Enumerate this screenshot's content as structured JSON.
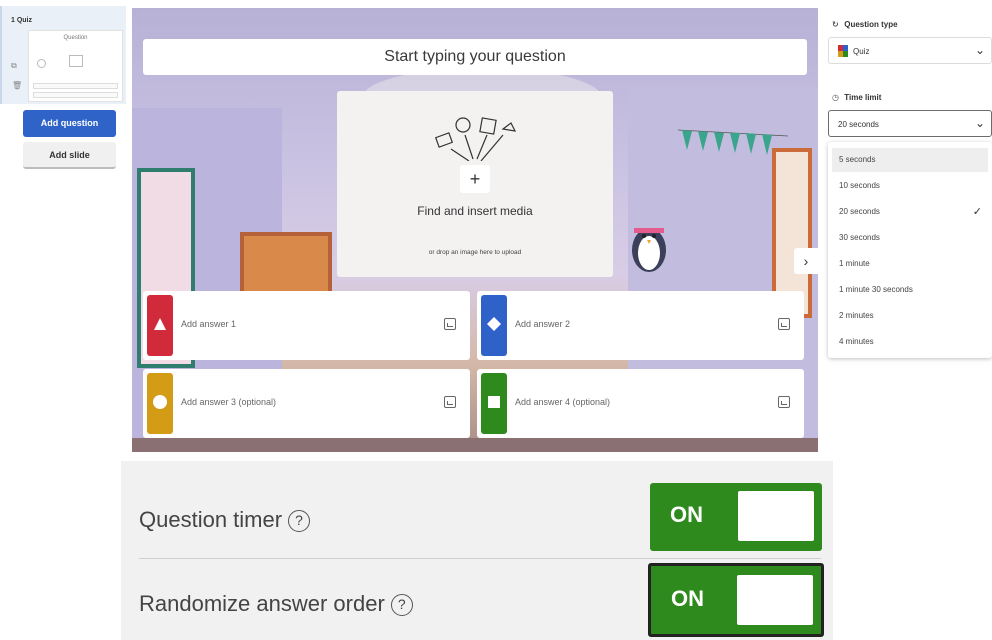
{
  "sidebar": {
    "slide": {
      "number_title": "1  Quiz",
      "thumb_label": "Question"
    },
    "add_question_label": "Add question",
    "add_slide_label": "Add slide"
  },
  "editor": {
    "question_placeholder": "Start typing your question",
    "media": {
      "title": "Find and insert media",
      "subtitle": "or drop an image here to upload"
    },
    "answers": [
      {
        "label": "Add answer 1",
        "color": "#d12a3a",
        "shape": "triangle"
      },
      {
        "label": "Add answer 2",
        "color": "#2f62c9",
        "shape": "diamond"
      },
      {
        "label": "Add answer 3 (optional)",
        "color": "#d49b17",
        "shape": "circle"
      },
      {
        "label": "Add answer 4 (optional)",
        "color": "#2e8a1d",
        "shape": "square"
      }
    ]
  },
  "right_panel": {
    "question_type_label": "Question type",
    "question_type_value": "Quiz",
    "time_limit_label": "Time limit",
    "time_limit_value": "20 seconds",
    "time_options": [
      "5 seconds",
      "10 seconds",
      "20 seconds",
      "30 seconds",
      "1 minute",
      "1 minute 30 seconds",
      "2 minutes",
      "4 minutes"
    ],
    "selected_option": "20 seconds",
    "hovered_option": "5 seconds"
  },
  "settings": {
    "question_timer": {
      "label": "Question timer",
      "state": "ON",
      "on": true
    },
    "randomize": {
      "label": "Randomize answer order",
      "state": "ON",
      "on": true
    },
    "help_glyph": "?"
  },
  "colors": {
    "primary_blue": "#2f63c8",
    "toggle_green": "#2e8a1d"
  }
}
